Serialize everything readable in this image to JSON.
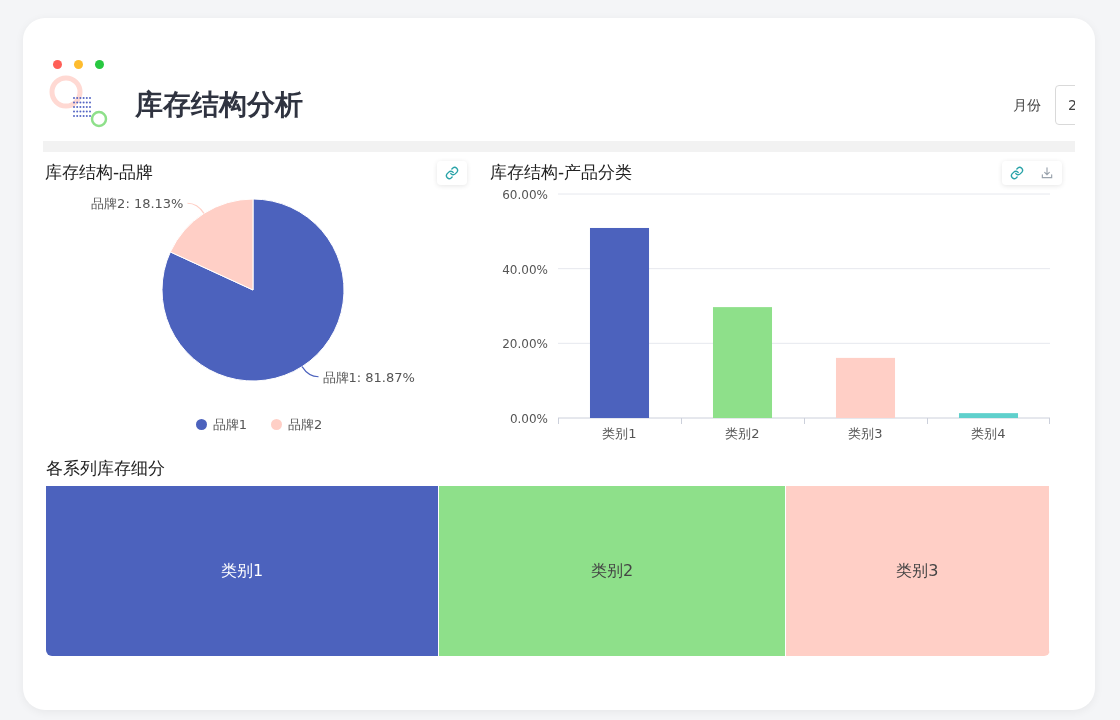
{
  "header": {
    "title": "库存结构分析",
    "window_dots": [
      {
        "color": "#ff5f57"
      },
      {
        "color": "#febc2e"
      },
      {
        "color": "#28c840"
      }
    ],
    "month_filter": {
      "label": "月份",
      "value": "2"
    }
  },
  "brand_panel": {
    "title": "库存结构-品牌",
    "chart_data": {
      "type": "pie",
      "categories": [
        "品牌1",
        "品牌2"
      ],
      "values": [
        81.87,
        18.13
      ],
      "legend": true,
      "colors": [
        "#4c62bd",
        "#ffcfc6"
      ],
      "value_labels": [
        "品牌1: 81.87%",
        "品牌2: 18.13%"
      ]
    }
  },
  "category_panel": {
    "title": "库存结构-产品分类",
    "chart_data": {
      "type": "bar",
      "categories": [
        "类别1",
        "类别2",
        "类别3",
        "类别4"
      ],
      "values": [
        50.9,
        29.7,
        16.1,
        1.3
      ],
      "colors": [
        "#4c62bd",
        "#8ee08a",
        "#ffcfc6",
        "#5fd0cc"
      ],
      "ylim": [
        0,
        60
      ],
      "yticks": [
        {
          "value": 0,
          "label": "0.00%"
        },
        {
          "value": 20,
          "label": "20.00%"
        },
        {
          "value": 40,
          "label": "40.00%"
        },
        {
          "value": 60,
          "label": "60.00%"
        }
      ]
    }
  },
  "series_panel": {
    "title": "各系列库存细分",
    "blocks": [
      {
        "label": "类别1",
        "color": "#4c62bd"
      },
      {
        "label": "类别2",
        "color": "#8ee08a"
      },
      {
        "label": "类别3",
        "color": "#ffcfc6"
      }
    ]
  }
}
